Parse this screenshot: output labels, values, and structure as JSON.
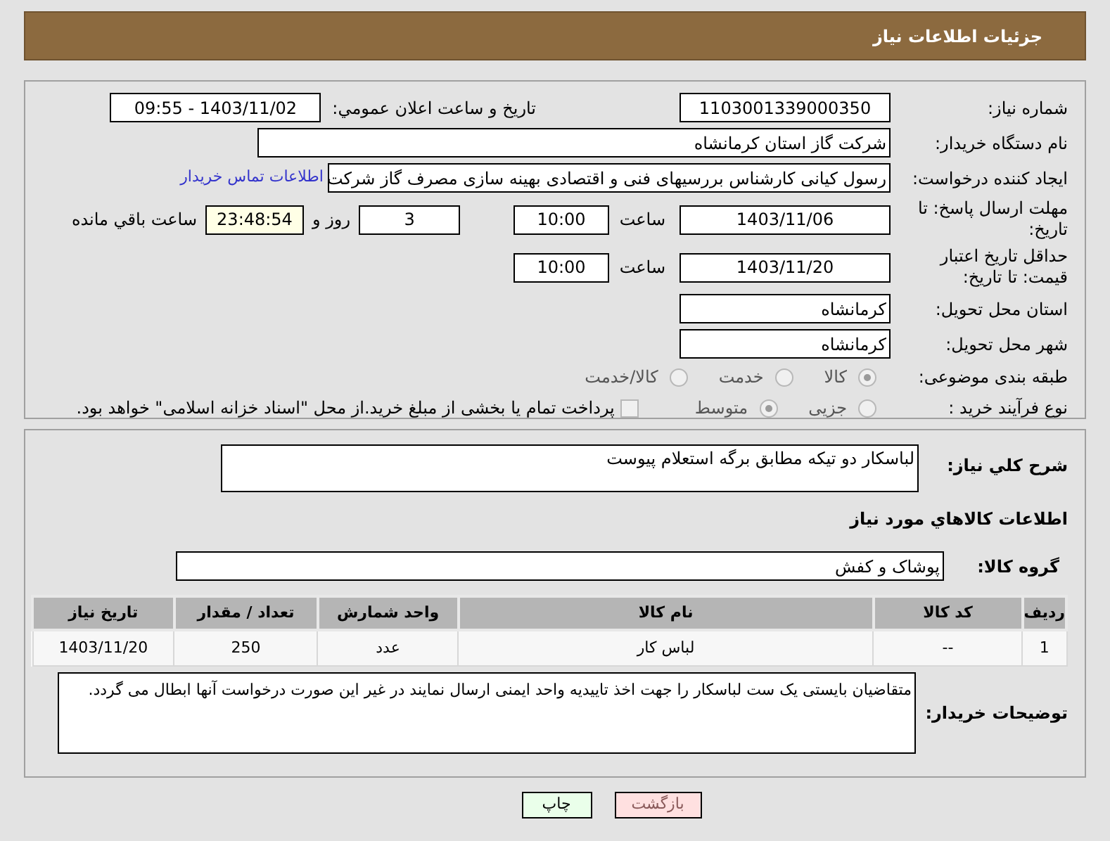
{
  "header": {
    "title": "جزئیات اطلاعات نیاز"
  },
  "details": {
    "need_number": {
      "label": "شماره نیاز:",
      "value": "1103001339000350"
    },
    "announce": {
      "label": "تاریخ و ساعت اعلان عمومي:",
      "value": "1403/11/02 - 09:55"
    },
    "buyer": {
      "label": "نام دستگاه خریدار:",
      "value": "شرکت گاز استان کرمانشاه"
    },
    "creator": {
      "label": "ایجاد کننده درخواست:",
      "value": "رسول کیانی کارشناس بررسیهای فنی و اقتصادی بهینه سازی مصرف گاز شرکت",
      "link": "اطلاعات تماس خریدار"
    },
    "deadline": {
      "label": "مهلت ارسال پاسخ: تا تاریخ:",
      "date": "1403/11/06",
      "time_label": "ساعت",
      "time": "10:00",
      "days": "3",
      "days_label": "روز و",
      "remaining": "23:48:54",
      "remaining_label": "ساعت باقي مانده"
    },
    "validity": {
      "label": "حداقل تاریخ اعتبار قیمت: تا تاریخ:",
      "date": "1403/11/20",
      "time_label": "ساعت",
      "time": "10:00"
    },
    "province": {
      "label": "استان محل تحویل:",
      "value": "کرمانشاه"
    },
    "city": {
      "label": "شهر محل تحویل:",
      "value": "کرمانشاه"
    },
    "category": {
      "label": "طبقه بندی موضوعی:",
      "options": [
        {
          "label": "کالا",
          "selected": true
        },
        {
          "label": "خدمت",
          "selected": false
        },
        {
          "label": "کالا/خدمت",
          "selected": false
        }
      ]
    },
    "purchase_type": {
      "label": "نوع فرآیند خرید :",
      "options": [
        {
          "label": "جزیی",
          "selected": false
        },
        {
          "label": "متوسط",
          "selected": true
        }
      ],
      "treasury": {
        "checked": false,
        "label": "پرداخت تمام یا بخشی از مبلغ خرید.از محل \"اسناد خزانه اسلامی\" خواهد بود."
      }
    }
  },
  "needs": {
    "description": {
      "label": "شرح کلي نياز:",
      "value": "لباسکار دو تیکه مطابق برگه استعلام پیوست"
    },
    "heading": "اطلاعات کالاهاي مورد نياز",
    "group": {
      "label": "گروه کالا:",
      "value": "پوشاک و کفش"
    },
    "table": {
      "columns": [
        "ردیف",
        "کد کالا",
        "نام کالا",
        "واحد شمارش",
        "تعداد / مقدار",
        "تاریخ نیاز"
      ],
      "rows": [
        [
          "1",
          "--",
          "لباس کار",
          "عدد",
          "250",
          "1403/11/20"
        ]
      ]
    },
    "notes": {
      "label": "توضیحات خریدار:",
      "value": "متقاضیان بایستی یک ست لباسکار را جهت اخذ تاییدیه واحد ایمنی ارسال نمایند در غیر این صورت درخواست آنها ابطال می گردد."
    }
  },
  "buttons": [
    {
      "kind": "back",
      "label": "بازگشت"
    },
    {
      "kind": "print",
      "label": "چاپ"
    }
  ]
}
